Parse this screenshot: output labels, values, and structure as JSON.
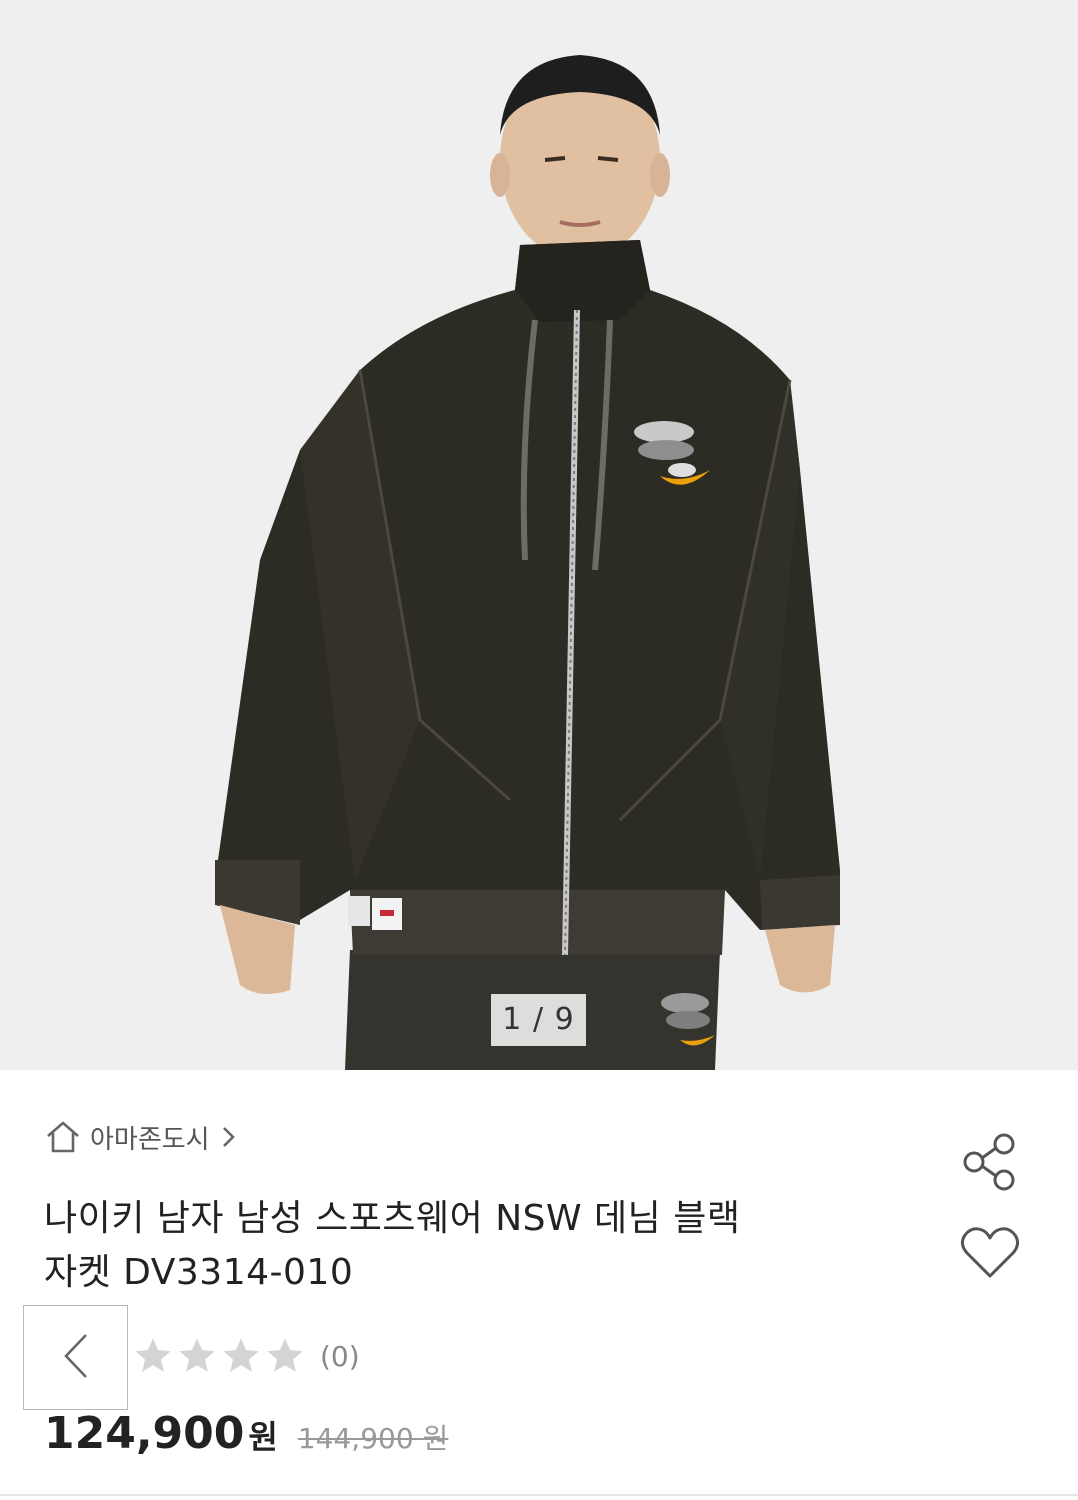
{
  "gallery": {
    "current": "1",
    "separator": "/",
    "total": "9",
    "photo_alt": "나이키 남자 남성 스포츠웨어 NSW 데님 블랙 자켓 DV3314-010"
  },
  "store": {
    "name": "아마존도시"
  },
  "product": {
    "title_line1": "나이키 남자 남성 스포츠웨어 NSW 데님 블랙",
    "title_line2": "자켓 DV3314-010",
    "rating_stars": 0,
    "review_count": "(0)",
    "price": "124,900",
    "price_unit": "원",
    "original_price": "144,900 원"
  },
  "icons": {
    "store": "home-icon",
    "store_link": "chevron-right-icon",
    "share": "share-icon",
    "like": "heart-icon",
    "back": "chevron-left-icon",
    "star": "star-icon"
  },
  "colors": {
    "background": "#ffffff",
    "photo_bg": "#efefef",
    "jacket": "#2c2b24",
    "text_primary": "#222222",
    "text_secondary": "#555555",
    "star_empty": "#d4d4d4",
    "accent_swoosh": "#e8a10a"
  }
}
